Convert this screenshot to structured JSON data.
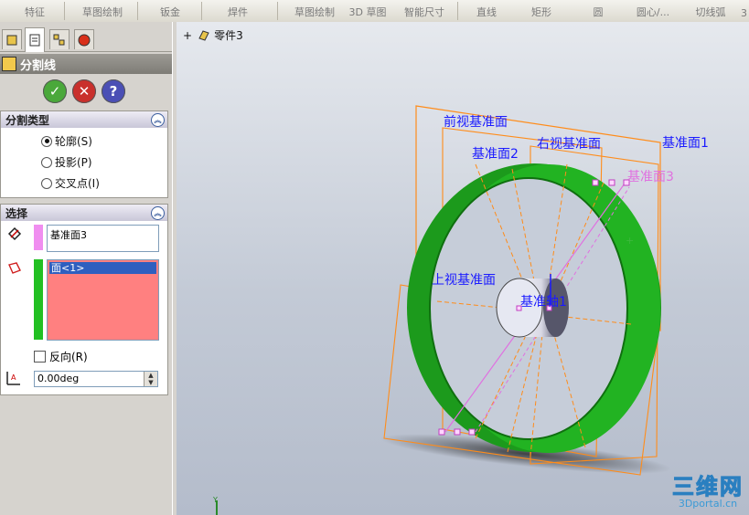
{
  "toolbar": {
    "items": [
      "特征",
      "草图绘制",
      "钣金",
      "焊件",
      "草图绘制",
      "3D 草图",
      "智能尺寸",
      "直线",
      "矩形",
      "圆",
      "圆心/...",
      "切线弧",
      "3"
    ]
  },
  "panel": {
    "title": "分割线",
    "split_type": {
      "header": "分割类型",
      "options": [
        {
          "label": "轮廓(S)",
          "selected": true
        },
        {
          "label": "投影(P)",
          "selected": false
        },
        {
          "label": "交叉点(I)",
          "selected": false
        }
      ]
    },
    "selection": {
      "header": "选择",
      "plane_value": "基准面3",
      "faces_value": "面<1>",
      "reverse_label": "反向(R)",
      "angle_value": "0.00deg"
    }
  },
  "tree": {
    "part_name": "零件3"
  },
  "scene": {
    "labels": {
      "front_plane": "前视基准面",
      "plane1": "基准面1",
      "plane2": "基准面2",
      "right_plane": "右视基准面",
      "plane3": "基准面3",
      "top_plane": "上视基准面",
      "axis1": "基准轴1"
    }
  },
  "watermark": {
    "logo": "三维网",
    "url": "3Dportal.cn"
  },
  "colors": {
    "ring": "#1ea21e",
    "plane_edge": "#ff8c1a",
    "label_blue": "#1a1aff",
    "label_pink": "#e070e0"
  }
}
